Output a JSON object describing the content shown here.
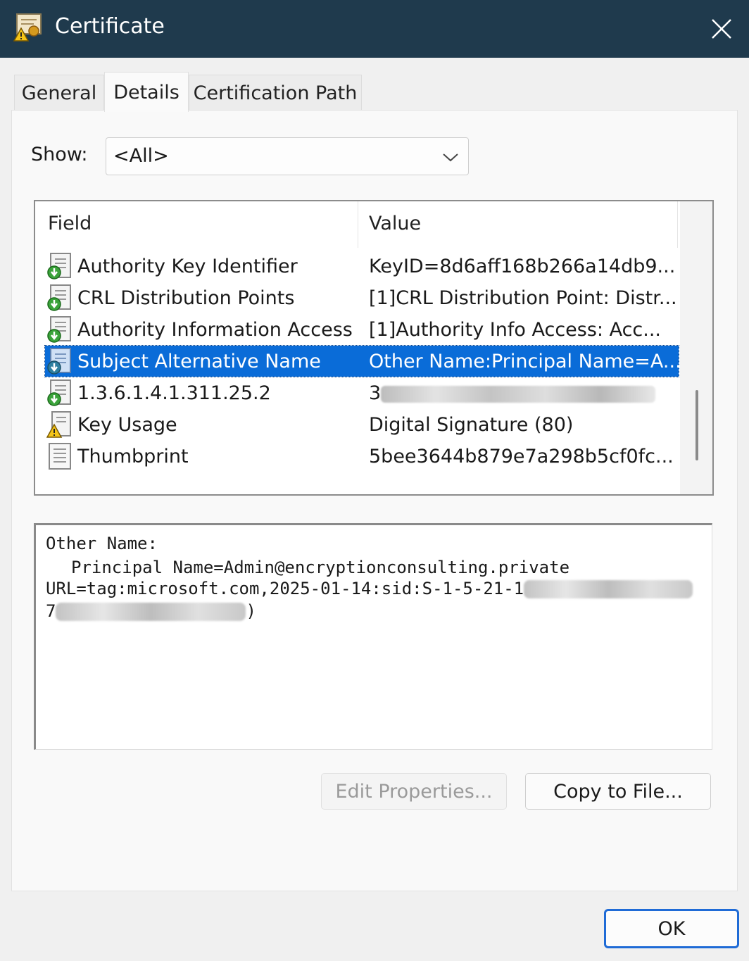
{
  "window": {
    "title": "Certificate"
  },
  "tabs": [
    {
      "label": "General"
    },
    {
      "label": "Details",
      "active": true
    },
    {
      "label": "Certification Path"
    }
  ],
  "show": {
    "label": "Show:",
    "value": "<All>"
  },
  "fields": {
    "headers": {
      "field": "Field",
      "value": "Value"
    },
    "rows": [
      {
        "field": "Authority Key Identifier",
        "value": "KeyID=8d6aff168b266a14db9...",
        "icon": "cert-extension-icon"
      },
      {
        "field": "CRL Distribution Points",
        "value": "[1]CRL Distribution Point: Distr...",
        "icon": "cert-extension-icon"
      },
      {
        "field": "Authority Information Access",
        "value": "[1]Authority Info Access: Acc...",
        "icon": "cert-extension-icon"
      },
      {
        "field": "Subject Alternative Name",
        "value": "Other Name:Principal Name=A...",
        "icon": "cert-extension-icon",
        "selected": true
      },
      {
        "field": "1.3.6.1.4.1.311.25.2",
        "value": "3",
        "icon": "cert-extension-icon",
        "redacted": true
      },
      {
        "field": "Key Usage",
        "value": "Digital Signature (80)",
        "icon": "cert-warning-icon"
      },
      {
        "field": "Thumbprint",
        "value": "5bee3644b879e7a298b5cf0fc...",
        "icon": "cert-property-icon"
      }
    ]
  },
  "detail": {
    "line1": "Other Name:",
    "line2": "Principal Name=Admin@encryptionconsulting.private",
    "line3": "URL=tag:microsoft.com,2025-01-14:sid:S-1-5-21-1",
    "line4_start": "7",
    "line4_end": ")"
  },
  "buttons": {
    "edit_properties": "Edit Properties...",
    "copy_to_file": "Copy to File...",
    "ok": "OK"
  },
  "colors": {
    "titlebar": "#1f3a4d",
    "selection": "#0a6cd8",
    "ok_border": "#1f6bd6"
  }
}
